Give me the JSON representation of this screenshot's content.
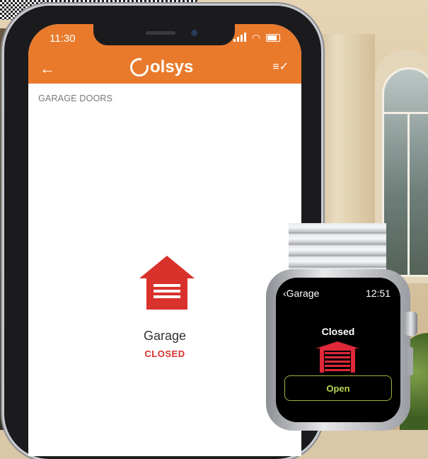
{
  "status_bar": {
    "time": "11:30"
  },
  "app": {
    "brand": "olsys",
    "section_label": "GARAGE DOORS",
    "device": {
      "name": "Garage",
      "status": "CLOSED"
    },
    "accent_color": "#e97a2c",
    "status_color": "#d9312b"
  },
  "watch": {
    "back_title": "Garage",
    "time": "12:51",
    "status": "Closed",
    "open_label": "Open"
  }
}
